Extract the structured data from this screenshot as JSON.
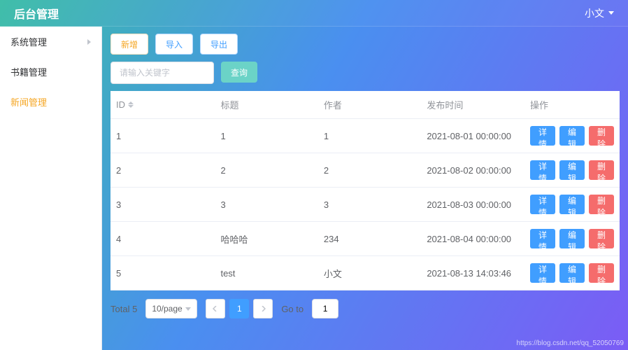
{
  "header": {
    "brand": "后台管理",
    "user": "小文"
  },
  "sidebar": {
    "items": [
      {
        "label": "系统管理",
        "expandable": true
      },
      {
        "label": "书籍管理",
        "expandable": false
      },
      {
        "label": "新闻管理",
        "expandable": false
      }
    ]
  },
  "toolbar": {
    "add": "新增",
    "import": "导入",
    "export": "导出"
  },
  "search": {
    "placeholder": "请输入关键字",
    "query_btn": "查询"
  },
  "table": {
    "columns": {
      "id": "ID",
      "title": "标题",
      "author": "作者",
      "pubtime": "发布时间",
      "ops": "操作"
    },
    "ops_labels": {
      "detail": "详情",
      "edit": "编辑",
      "delete": "删除"
    },
    "rows": [
      {
        "id": "1",
        "title": "1",
        "author": "1",
        "pubtime": "2021-08-01 00:00:00"
      },
      {
        "id": "2",
        "title": "2",
        "author": "2",
        "pubtime": "2021-08-02 00:00:00"
      },
      {
        "id": "3",
        "title": "3",
        "author": "3",
        "pubtime": "2021-08-03 00:00:00"
      },
      {
        "id": "4",
        "title": "哈哈哈",
        "author": "234",
        "pubtime": "2021-08-04 00:00:00"
      },
      {
        "id": "5",
        "title": "test",
        "author": "小文",
        "pubtime": "2021-08-13 14:03:46"
      }
    ]
  },
  "pagination": {
    "total_label": "Total 5",
    "page_size": "10/page",
    "current": "1",
    "goto_label": "Go to",
    "goto_value": "1"
  },
  "watermark": "https://blog.csdn.net/qq_52050769"
}
